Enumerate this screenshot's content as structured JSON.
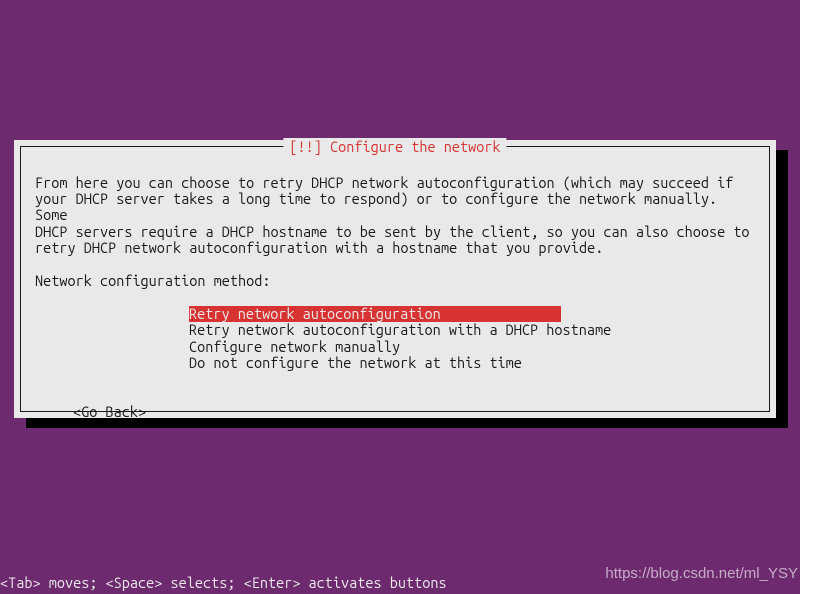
{
  "dialog": {
    "title_prefix": "[!!]",
    "title": "Configure the network",
    "description": "From here you can choose to retry DHCP network autoconfiguration (which may succeed if\nyour DHCP server takes a long time to respond) or to configure the network manually. Some\nDHCP servers require a DHCP hostname to be sent by the client, so you can also choose to\nretry DHCP network autoconfiguration with a hostname that you provide.",
    "prompt_label": "Network configuration method:",
    "options": [
      "Retry network autoconfiguration",
      "Retry network autoconfiguration with a DHCP hostname",
      "Configure network manually",
      "Do not configure the network at this time"
    ],
    "selected_index": 0,
    "go_back_label": "<Go Back>"
  },
  "footer": {
    "help_text": "<Tab> moves; <Space> selects; <Enter> activates buttons"
  },
  "watermark": {
    "text": "https://blog.csdn.net/ml_YSY"
  }
}
